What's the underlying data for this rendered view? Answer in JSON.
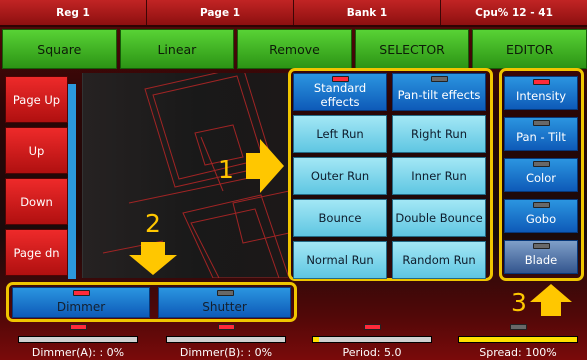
{
  "status_bar": {
    "reg": "Reg 1",
    "page": "Page 1",
    "bank": "Bank 1",
    "cpu": "Cpu% 12 - 41"
  },
  "mode_buttons": [
    "Square",
    "Linear",
    "Remove",
    "SELECTOR",
    "EDITOR"
  ],
  "nav_buttons": [
    "Page Up",
    "Up",
    "Down",
    "Page dn"
  ],
  "effects": [
    {
      "label": "Standard effects",
      "lamp": "red",
      "style": "blue"
    },
    {
      "label": "Pan-tilt effects",
      "lamp": "off",
      "style": "blue"
    },
    {
      "label": "Left Run"
    },
    {
      "label": "Right Run"
    },
    {
      "label": "Outer Run"
    },
    {
      "label": "Inner Run"
    },
    {
      "label": "Bounce"
    },
    {
      "label": "Double Bounce"
    },
    {
      "label": "Normal Run"
    },
    {
      "label": "Random Run"
    }
  ],
  "attributes": [
    {
      "label": "Intensity",
      "lamp": "red"
    },
    {
      "label": "Pan - Tilt",
      "lamp": "off"
    },
    {
      "label": "Color",
      "lamp": "off"
    },
    {
      "label": "Gobo",
      "lamp": "off"
    },
    {
      "label": "Blade",
      "lamp": "off"
    }
  ],
  "groups": [
    {
      "label": "Dimmer",
      "lamp": "red"
    },
    {
      "label": "Shutter",
      "lamp": "off"
    }
  ],
  "parameters": [
    {
      "label": "Dimmer(A): : 0%",
      "value_pct": 0,
      "lamp": "red",
      "fill_color": "#ffe000"
    },
    {
      "label": "Dimmer(B): : 0%",
      "value_pct": 0,
      "lamp": "red",
      "fill_color": "#ffe000"
    },
    {
      "label": "Period: 5.0",
      "value_pct": 5,
      "lamp": "red",
      "fill_color": "#ffe000"
    },
    {
      "label": "Spread: 100%",
      "value_pct": 100,
      "lamp": "off",
      "fill_color": "#ffe000"
    }
  ],
  "callouts": [
    "1",
    "2",
    "3"
  ],
  "colors": {
    "accent": "#f0c500",
    "mode_green": "#3fb71e",
    "button_blue": "#1a78d0",
    "effect_cyan": "#78d3ec",
    "nav_red": "#d81c1c"
  }
}
